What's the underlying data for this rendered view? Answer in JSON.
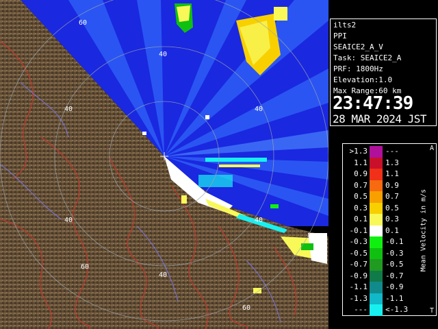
{
  "radar": {
    "range_labels": [
      "60",
      "40",
      "40",
      "40",
      "60",
      "40",
      "40",
      "60",
      "40"
    ],
    "colors": {
      "sky": "#2a55f2",
      "ocean": "#1a28e0",
      "land": "#5a4833",
      "land_light": "#8a7251",
      "river": "#c03a2a",
      "ring": "#9aa6b0"
    }
  },
  "info": {
    "site": "ilts2",
    "mode": "PPI",
    "scan": "SEAICE2_A_V",
    "task": "Task: SEAICE2_A",
    "prf": "PRF: 1800Hz",
    "elevation": "Elevation:1.0",
    "max_range": "Max Range:60 km",
    "time": "23:47:39",
    "date": "28 MAR 2024 JST"
  },
  "legend": {
    "title": "Mean Velocity in m/s",
    "top_mark": "A",
    "bottom_mark": "T",
    "rows": [
      {
        "left": ">1.3",
        "right": "---",
        "color": "#b0109a"
      },
      {
        "left": "1.1",
        "right": "1.3",
        "color": "#c8102a"
      },
      {
        "left": "0.9",
        "right": "1.1",
        "color": "#f03018"
      },
      {
        "left": "0.7",
        "right": "0.9",
        "color": "#f86a10"
      },
      {
        "left": "0.5",
        "right": "0.7",
        "color": "#f8a000"
      },
      {
        "left": "0.3",
        "right": "0.5",
        "color": "#f8d000"
      },
      {
        "left": "0.1",
        "right": "0.3",
        "color": "#f8f858"
      },
      {
        "left": "-0.1",
        "right": "0.1",
        "color": "#ffffff"
      },
      {
        "left": "-0.3",
        "right": "-0.1",
        "color": "#10f010"
      },
      {
        "left": "-0.5",
        "right": "-0.3",
        "color": "#10c010"
      },
      {
        "left": "-0.7",
        "right": "-0.5",
        "color": "#209a20"
      },
      {
        "left": "-0.9",
        "right": "-0.7",
        "color": "#107a48"
      },
      {
        "left": "-1.1",
        "right": "-0.9",
        "color": "#108a8a"
      },
      {
        "left": "-1.3",
        "right": "-1.1",
        "color": "#10b8c8"
      },
      {
        "left": "---",
        "right": "<-1.3",
        "color": "#18f0f0"
      }
    ]
  }
}
